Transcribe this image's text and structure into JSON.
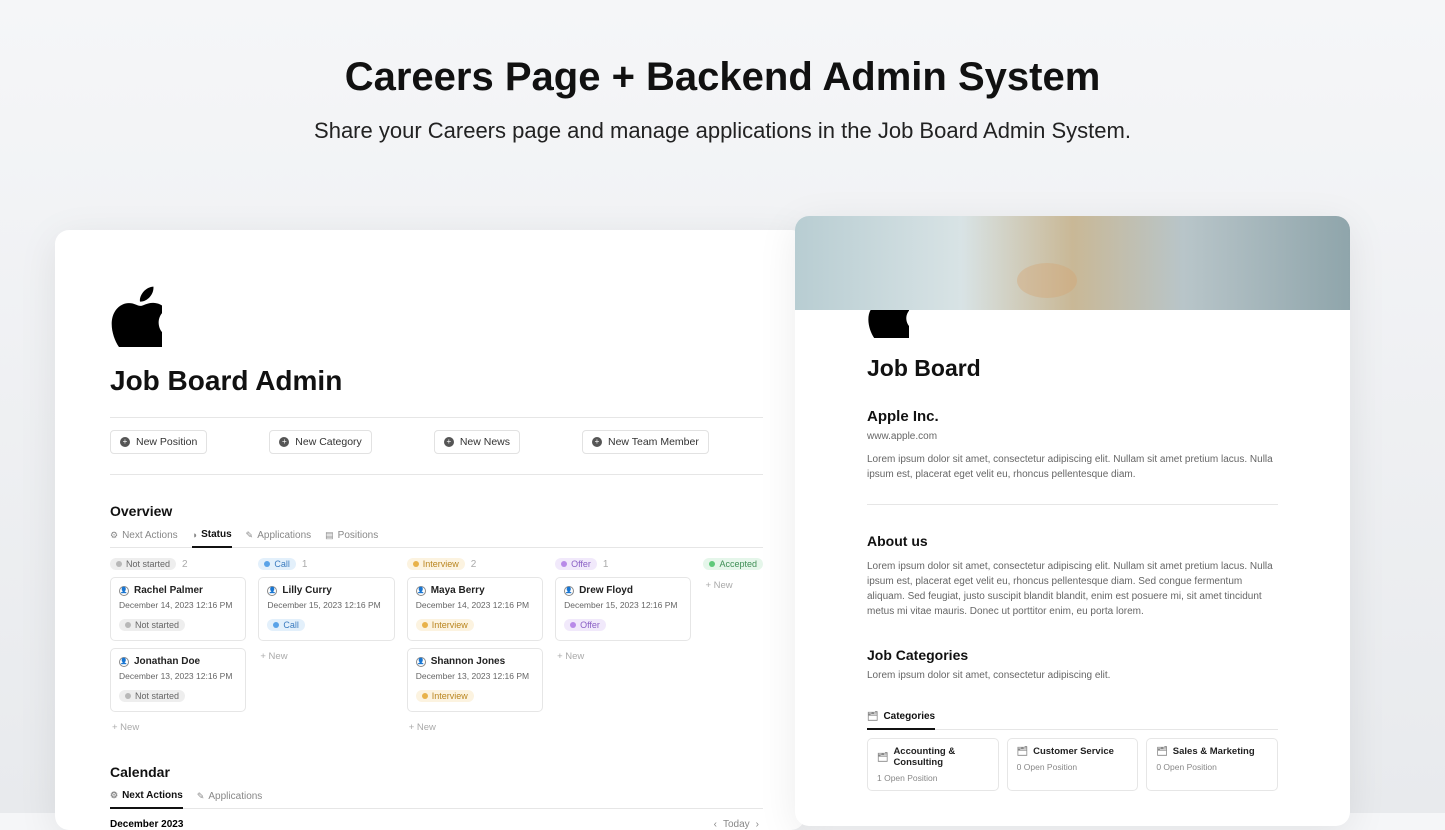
{
  "hero": {
    "title": "Careers Page + Backend Admin System",
    "subtitle": "Share your Careers page and manage applications in the Job Board Admin System."
  },
  "admin": {
    "title": "Job Board Admin",
    "buttons": [
      "New Position",
      "New Category",
      "New News",
      "New Team Member"
    ],
    "overview": {
      "heading": "Overview",
      "tabs": [
        "Next Actions",
        "Status",
        "Applications",
        "Positions"
      ],
      "active_tab": "Status",
      "columns": [
        {
          "label": "Not started",
          "count": "2",
          "pill_class": "pill-grey",
          "dot_class": "dot-grey",
          "cards": [
            {
              "name": "Rachel Palmer",
              "date": "December 14, 2023 12:16 PM",
              "tag": "Not started"
            },
            {
              "name": "Jonathan Doe",
              "date": "December 13, 2023 12:16 PM",
              "tag": "Not started"
            }
          ]
        },
        {
          "label": "Call",
          "count": "1",
          "pill_class": "pill-blue",
          "dot_class": "dot-blue",
          "cards": [
            {
              "name": "Lilly Curry",
              "date": "December 15, 2023 12:16 PM",
              "tag": "Call"
            }
          ]
        },
        {
          "label": "Interview",
          "count": "2",
          "pill_class": "pill-yellow",
          "dot_class": "dot-yellow",
          "cards": [
            {
              "name": "Maya Berry",
              "date": "December 14, 2023 12:16 PM",
              "tag": "Interview"
            },
            {
              "name": "Shannon Jones",
              "date": "December 13, 2023 12:16 PM",
              "tag": "Interview"
            }
          ]
        },
        {
          "label": "Offer",
          "count": "1",
          "pill_class": "pill-purple",
          "dot_class": "dot-purple",
          "cards": [
            {
              "name": "Drew Floyd",
              "date": "December 15, 2023 12:16 PM",
              "tag": "Offer"
            }
          ]
        },
        {
          "label": "Accepted",
          "count": "",
          "pill_class": "pill-green",
          "dot_class": "dot-green",
          "cards": []
        }
      ],
      "new_label": "+ New"
    },
    "calendar": {
      "heading": "Calendar",
      "tabs": [
        "Next Actions",
        "Applications"
      ],
      "month": "December 2023",
      "today": "Today"
    }
  },
  "board": {
    "title": "Job Board",
    "company": "Apple Inc.",
    "url": "www.apple.com",
    "intro": "Lorem ipsum dolor sit amet, consectetur adipiscing elit. Nullam sit amet pretium lacus. Nulla ipsum est, placerat eget velit eu, rhoncus pellentesque diam.",
    "about_h": "About us",
    "about_p": "Lorem ipsum dolor sit amet, consectetur adipiscing elit. Nullam sit amet pretium lacus. Nulla ipsum est, placerat eget velit eu, rhoncus pellentesque diam. Sed congue fermentum aliquam. Sed feugiat, justo suscipit blandit blandit, enim est posuere mi, sit amet tincidunt metus mi vitae mauris. Donec ut porttitor enim, eu porta lorem.",
    "cat_h": "Job Categories",
    "cat_p": "Lorem ipsum dolor sit amet, consectetur adipiscing elit.",
    "cat_tab": "Categories",
    "cats": [
      {
        "name": "Accounting & Consulting",
        "count": "1 Open Position"
      },
      {
        "name": "Customer Service",
        "count": "0 Open Position"
      },
      {
        "name": "Sales & Marketing",
        "count": "0 Open Position"
      }
    ]
  }
}
